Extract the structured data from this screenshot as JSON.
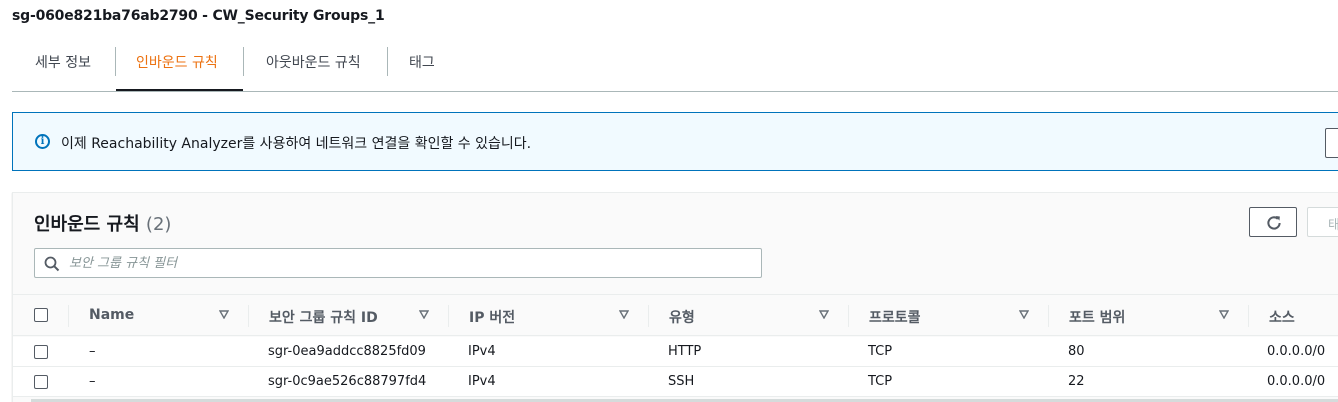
{
  "page": {
    "title": "sg-060e821ba76ab2790 - CW_Security Groups_1"
  },
  "tabs": [
    {
      "label": "세부 정보",
      "active": false
    },
    {
      "label": "인바운드 규칙",
      "active": true
    },
    {
      "label": "아웃바운드 규칙",
      "active": false
    },
    {
      "label": "태그",
      "active": false
    }
  ],
  "info_alert": {
    "icon": "info-icon",
    "text": "이제 Reachability Analyzer를 사용하여 네트워크 연결을 확인할 수 있습니다."
  },
  "rules": {
    "title": "인바운드 규칙",
    "count": "(2)",
    "refresh_icon": "refresh-icon",
    "edge_button_label": "태그",
    "search": {
      "placeholder": "보안 그룹 규칙 필터",
      "value": ""
    },
    "columns": [
      "Name",
      "보안 그룹 규칙 ID",
      "IP 버전",
      "유형",
      "프로토콜",
      "포트 범위",
      "소스"
    ],
    "rows": [
      {
        "name": "–",
        "id": "sgr-0ea9addcc8825fd09",
        "ip_version": "IPv4",
        "type": "HTTP",
        "protocol": "TCP",
        "port_range": "80",
        "source": "0.0.0.0/0"
      },
      {
        "name": "–",
        "id": "sgr-0c9ae526c88797fd4",
        "ip_version": "IPv4",
        "type": "SSH",
        "protocol": "TCP",
        "port_range": "22",
        "source": "0.0.0.0/0"
      }
    ]
  },
  "colors": {
    "accent": "#ec7211",
    "info_blue": "#0073bb",
    "text": "#16191f",
    "muted": "#545b64"
  }
}
